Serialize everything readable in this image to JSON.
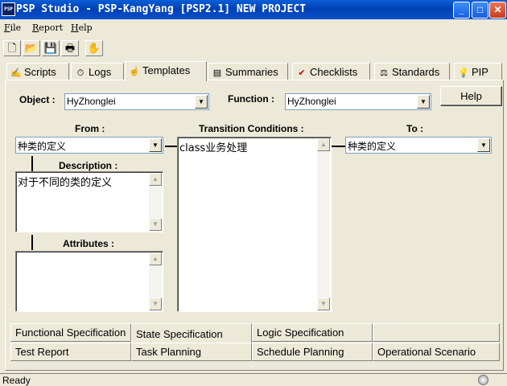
{
  "window": {
    "title": "PSP Studio - PSP-KangYang [PSP2.1] NEW PROJECT",
    "logo_text": "PSP",
    "minimize": "_",
    "maximize": "□",
    "close": "✕"
  },
  "menu": [
    {
      "key": "F",
      "rest": "ile"
    },
    {
      "key": "R",
      "rest": "eport"
    },
    {
      "key": "H",
      "rest": "elp"
    }
  ],
  "toolbar": {
    "new": "🗋",
    "open": "📂",
    "save": "💾",
    "print": "🖶",
    "wizard": "✋"
  },
  "tabs": [
    {
      "label": "Scripts",
      "icon": "✍",
      "icon_name": "scripts-icon"
    },
    {
      "label": "Logs",
      "icon": "⏱",
      "icon_name": "logs-icon"
    },
    {
      "label": "Templates",
      "icon": "☝",
      "icon_name": "templates-icon"
    },
    {
      "label": "Summaries",
      "icon": "▤",
      "icon_name": "summaries-icon"
    },
    {
      "label": "Checklists",
      "icon": "✔",
      "icon_name": "checklists-icon"
    },
    {
      "label": "Standards",
      "icon": "⚖",
      "icon_name": "standards-icon"
    },
    {
      "label": "PIP",
      "icon": "💡",
      "icon_name": "pip-icon"
    }
  ],
  "form": {
    "object_label": "Object :",
    "object_value": "HyZhonglei",
    "function_label": "Function :",
    "function_value": "HyZhonglei",
    "help_button": "Help",
    "from_label": "From :",
    "from_value": "种类的定义",
    "transition_label": "Transition Conditions :",
    "transition_value": "class业务处理",
    "to_label": "To :",
    "to_value": "种类的定义",
    "description_label": "Description :",
    "description_value": "对于不同的类的定义",
    "attributes_label": "Attributes :",
    "attributes_value": ""
  },
  "bottom_tabs": {
    "row1": [
      "Functional Specification",
      "State Specification",
      "Logic Specification",
      ""
    ],
    "row2": [
      "Test Report",
      "Task Planning",
      "Schedule Planning",
      "Operational Scenario"
    ],
    "active": "State Specification"
  },
  "status": {
    "text": "Ready"
  },
  "colors": {
    "titlebar": "#0a4fcc",
    "face": "#ece9d8",
    "checklist_icon": "#cc0000"
  }
}
